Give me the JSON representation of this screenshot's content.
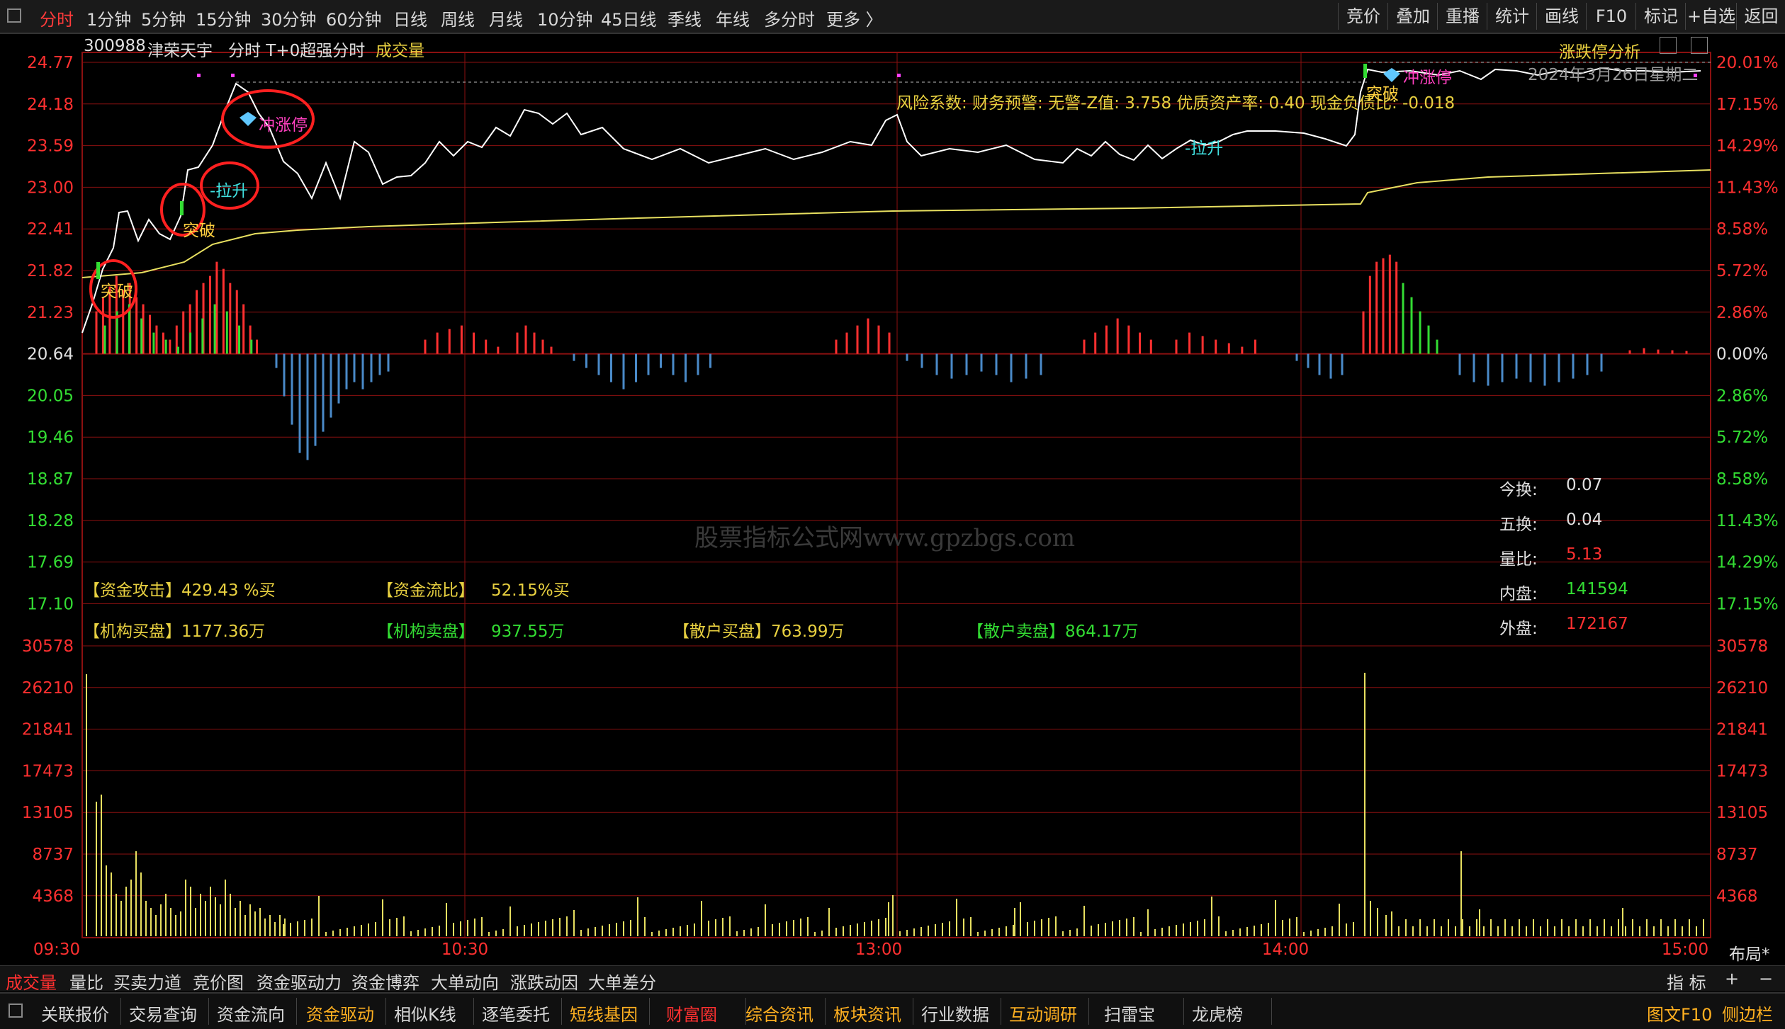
{
  "period_tabs": [
    "分时",
    "1分钟",
    "5分钟",
    "15分钟",
    "30分钟",
    "60分钟",
    "日线",
    "周线",
    "月线",
    "10分钟",
    "45日线",
    "季线",
    "年线",
    "多分时",
    "更多 〉"
  ],
  "right_buttons": [
    "竞价",
    "叠加",
    "重播",
    "统计",
    "画线",
    "F10",
    "标记",
    "+自选",
    "返回"
  ],
  "header": {
    "code": "300988",
    "name": "津荣天宇",
    "mode": "分时  T+0超强分时",
    "indicator": "成交量",
    "right_title": "涨跌停分析",
    "date": "2024年3月26日星期二"
  },
  "risk_text": "风险系数: 财务预警: 无警-Z值: 3.758  优质资产率: 0.40  现金负债比: -0.018",
  "price_axis_left": [
    "24.77",
    "24.18",
    "23.59",
    "23.00",
    "22.41",
    "21.82",
    "21.23",
    "20.64",
    "20.05",
    "19.46",
    "18.87",
    "18.28",
    "17.69",
    "17.10"
  ],
  "pct_axis_right": [
    "20.01%",
    "17.15%",
    "14.29%",
    "11.43%",
    "8.58%",
    "5.72%",
    "2.86%",
    "0.00%",
    "2.86%",
    "5.72%",
    "8.58%",
    "11.43%",
    "14.29%",
    "17.15%"
  ],
  "vol_axis": [
    "30578",
    "26210",
    "21841",
    "17473",
    "13105",
    "8737",
    "4368"
  ],
  "time_axis": [
    "09:30",
    "10:30",
    "13:00",
    "14:00",
    "15:00"
  ],
  "layout_btn": "布局*",
  "annotations": {
    "break1": "突破",
    "break2": "突破",
    "lift1": "-拉升",
    "limit1": "冲涨停",
    "lift2": "-拉升",
    "break3": "突破",
    "limit2": "冲涨停"
  },
  "stats": [
    {
      "label": "今换:",
      "value": "0.07",
      "color": "#e0e0e0"
    },
    {
      "label": "五换:",
      "value": "0.04",
      "color": "#e0e0e0"
    },
    {
      "label": "量比:",
      "value": "5.13",
      "color": "#ff3030"
    },
    {
      "label": "内盘:",
      "value": "141594",
      "color": "#33dd33"
    },
    {
      "label": "外盘:",
      "value": "172167",
      "color": "#ff3030"
    }
  ],
  "fund_row1": {
    "attack_label": "【资金攻击】",
    "attack_value": "429.43 %买",
    "flow_label": "【资金流比】",
    "flow_value": "52.15%买"
  },
  "fund_row2": {
    "inst_buy_label": "【机构买盘】",
    "inst_buy_value": "1177.36万",
    "inst_sell_label": "【机构卖盘】",
    "inst_sell_value": "937.55万",
    "retail_buy_label": "【散户买盘】",
    "retail_buy_value": "763.99万",
    "retail_sell_label": "【散户卖盘】",
    "retail_sell_value": "864.17万"
  },
  "watermark": "股票指标公式网www.gpzbgs.com",
  "indicator_tabs": [
    "成交量",
    "量比",
    "买卖力道",
    "竞价图",
    "资金驱动力",
    "资金博弈",
    "大单动向",
    "涨跌动因",
    "大单差分"
  ],
  "indicator_right": [
    "指 标",
    "+",
    "−"
  ],
  "bottom_tabs": [
    {
      "label": "关联报价",
      "color": "#d8d8d8"
    },
    {
      "label": "交易查询",
      "color": "#d8d8d8"
    },
    {
      "label": "资金流向",
      "color": "#d8d8d8"
    },
    {
      "label": "资金驱动",
      "color": "#ffb020"
    },
    {
      "label": "相似K线",
      "color": "#d8d8d8"
    },
    {
      "label": "逐笔委托",
      "color": "#d8d8d8"
    },
    {
      "label": "短线基因",
      "color": "#ffb020"
    },
    {
      "label": "财富圈",
      "color": "#ff3030"
    },
    {
      "label": "综合资讯",
      "color": "#ffb020"
    },
    {
      "label": "板块资讯",
      "color": "#ffb020"
    },
    {
      "label": "行业数据",
      "color": "#d8d8d8"
    },
    {
      "label": "互动调研",
      "color": "#ffb020"
    },
    {
      "label": "扫雷宝",
      "color": "#d8d8d8"
    },
    {
      "label": "龙虎榜",
      "color": "#d8d8d8"
    }
  ],
  "bottom_right": [
    "图文F10",
    "侧边栏"
  ],
  "colors": {
    "up": "#ff3030",
    "down": "#33dd33",
    "price_line": "#ffffff",
    "avg_line": "#e8e060",
    "grid": "#8b1010",
    "volume": "#e8e060"
  }
}
